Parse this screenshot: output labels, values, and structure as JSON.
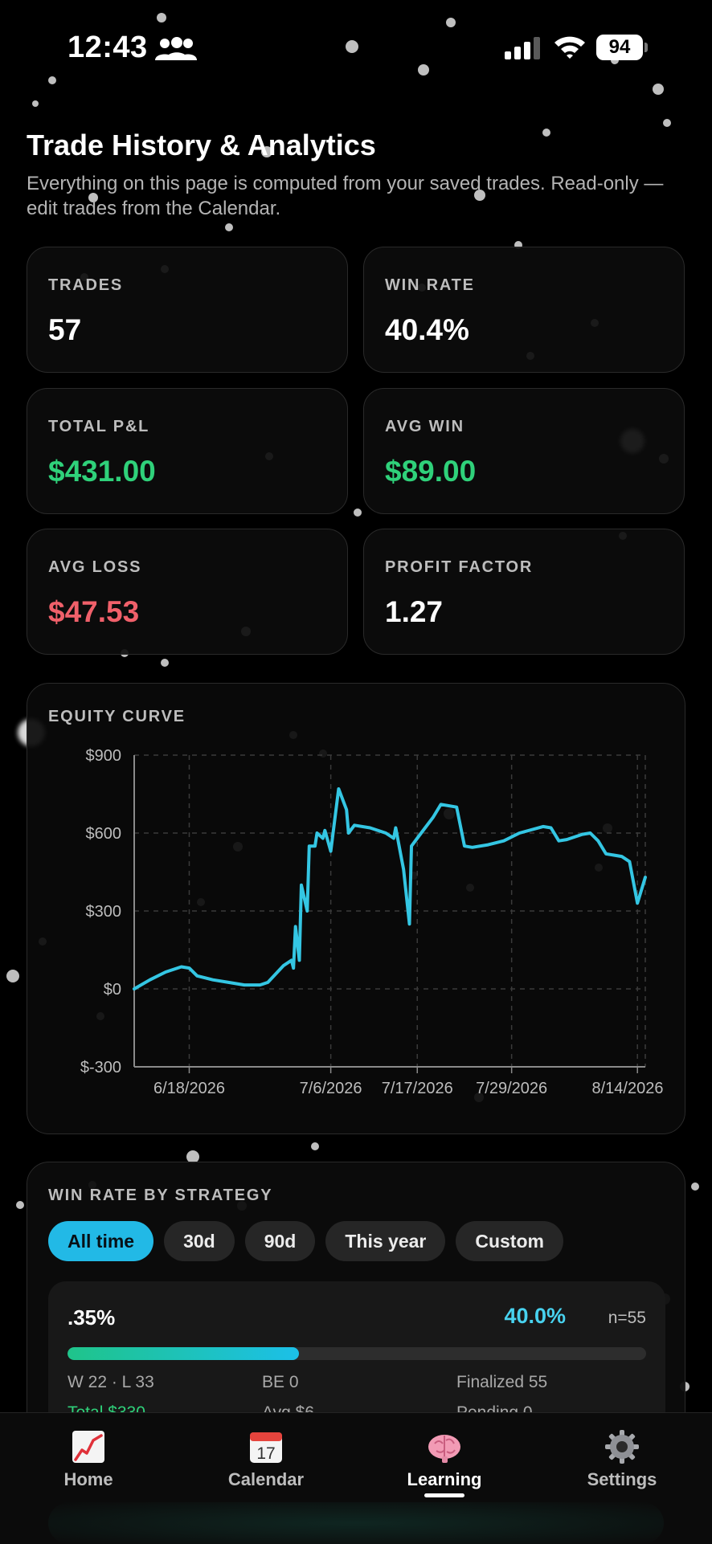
{
  "status_bar": {
    "time": "12:43",
    "battery": "94",
    "icons": [
      "people-icon",
      "signal-icon",
      "wifi-icon",
      "battery-icon"
    ]
  },
  "header": {
    "title": "Trade History & Analytics",
    "subtitle": "Everything on this page is computed from your saved trades. Read-only — edit trades from the Calendar."
  },
  "stats": [
    {
      "label": "TRADES",
      "value": "57",
      "tone": "neutral"
    },
    {
      "label": "WIN RATE",
      "value": "40.4%",
      "tone": "neutral"
    },
    {
      "label": "TOTAL P&L",
      "value": "$431.00",
      "tone": "positive"
    },
    {
      "label": "AVG WIN",
      "value": "$89.00",
      "tone": "positive"
    },
    {
      "label": "AVG LOSS",
      "value": "$47.53",
      "tone": "negative"
    },
    {
      "label": "PROFIT FACTOR",
      "value": "1.27",
      "tone": "neutral"
    }
  ],
  "equity_curve": {
    "label": "EQUITY CURVE"
  },
  "chart_data": {
    "type": "line",
    "title": "EQUITY CURVE",
    "xlabel": "",
    "ylabel": "",
    "line_color": "#34c6e3",
    "grid": true,
    "ylim": [
      -300,
      900
    ],
    "y_ticks": [
      "$900",
      "$600",
      "$300",
      "$0",
      "$-300"
    ],
    "y_tick_values": [
      900,
      600,
      300,
      0,
      -300
    ],
    "x_ticks": [
      "6/18/2026",
      "7/6/2026",
      "7/17/2026",
      "7/29/2026",
      "8/14/2026"
    ],
    "x_tick_dates": [
      "2026-06-18",
      "2026-07-06",
      "2026-07-17",
      "2026-07-29",
      "2026-08-14"
    ],
    "points": [
      [
        "2026-06-11",
        0
      ],
      [
        "2026-06-13",
        35
      ],
      [
        "2026-06-15",
        65
      ],
      [
        "2026-06-17",
        85
      ],
      [
        "2026-06-18",
        80
      ],
      [
        "2026-06-19",
        50
      ],
      [
        "2026-06-21",
        35
      ],
      [
        "2026-06-23",
        25
      ],
      [
        "2026-06-25",
        15
      ],
      [
        "2026-06-27",
        15
      ],
      [
        "2026-06-28",
        25
      ],
      [
        "2026-06-30",
        90
      ],
      [
        "2026-07-01",
        110
      ],
      [
        "2026-07-01",
        80
      ],
      [
        "2026-07-01",
        240
      ],
      [
        "2026-07-02",
        110
      ],
      [
        "2026-07-02",
        400
      ],
      [
        "2026-07-03",
        300
      ],
      [
        "2026-07-03",
        550
      ],
      [
        "2026-07-04",
        550
      ],
      [
        "2026-07-04",
        600
      ],
      [
        "2026-07-05",
        580
      ],
      [
        "2026-07-05",
        610
      ],
      [
        "2026-07-06",
        530
      ],
      [
        "2026-07-07",
        770
      ],
      [
        "2026-07-08",
        690
      ],
      [
        "2026-07-08",
        600
      ],
      [
        "2026-07-09",
        630
      ],
      [
        "2026-07-11",
        620
      ],
      [
        "2026-07-13",
        600
      ],
      [
        "2026-07-14",
        580
      ],
      [
        "2026-07-14",
        620
      ],
      [
        "2026-07-15",
        500
      ],
      [
        "2026-07-15",
        460
      ],
      [
        "2026-07-16",
        250
      ],
      [
        "2026-07-16",
        550
      ],
      [
        "2026-07-17",
        580
      ],
      [
        "2026-07-18",
        620
      ],
      [
        "2026-07-19",
        660
      ],
      [
        "2026-07-20",
        710
      ],
      [
        "2026-07-22",
        700
      ],
      [
        "2026-07-23",
        550
      ],
      [
        "2026-07-24",
        545
      ],
      [
        "2026-07-26",
        555
      ],
      [
        "2026-07-28",
        570
      ],
      [
        "2026-07-30",
        600
      ],
      [
        "2026-08-02",
        625
      ],
      [
        "2026-08-03",
        620
      ],
      [
        "2026-08-04",
        570
      ],
      [
        "2026-08-05",
        575
      ],
      [
        "2026-08-07",
        595
      ],
      [
        "2026-08-08",
        600
      ],
      [
        "2026-08-09",
        570
      ],
      [
        "2026-08-10",
        520
      ],
      [
        "2026-08-12",
        510
      ],
      [
        "2026-08-13",
        490
      ],
      [
        "2026-08-14",
        330
      ],
      [
        "2026-08-15",
        430
      ]
    ]
  },
  "strategy": {
    "label": "WIN RATE BY STRATEGY",
    "filters": [
      "All time",
      "30d",
      "90d",
      "This year",
      "Custom"
    ],
    "active_filter": "All time",
    "rows": [
      {
        "name": ".35%",
        "win_rate": "40.0%",
        "win_rate_value": 0.4,
        "n": "n=55",
        "wl": "W 22 · L 33",
        "be": "BE 0",
        "finalized": "Finalized 55",
        "total": "Total $330",
        "avg": "Avg $6",
        "pending": "Pending 0"
      }
    ]
  },
  "tabbar": {
    "items": [
      {
        "label": "Home",
        "icon": "chart-up-icon"
      },
      {
        "label": "Calendar",
        "icon": "calendar-icon",
        "icon_text": "17"
      },
      {
        "label": "Learning",
        "icon": "brain-icon"
      },
      {
        "label": "Settings",
        "icon": "gear-icon"
      }
    ],
    "active": "Learning"
  }
}
